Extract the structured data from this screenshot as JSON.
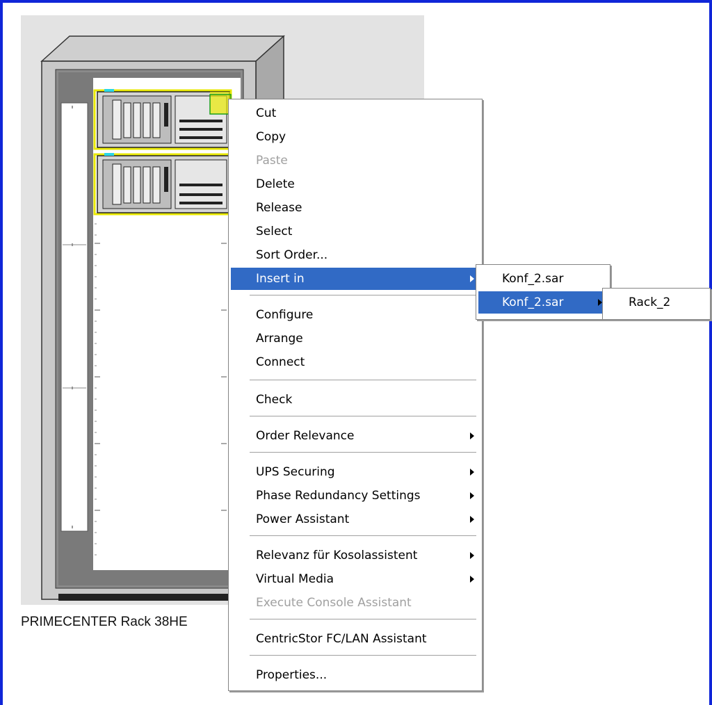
{
  "rack": {
    "label": "PRIMECENTER Rack 38HE"
  },
  "context_menu": {
    "items": [
      {
        "label": "Cut"
      },
      {
        "label": "Copy"
      },
      {
        "label": "Paste"
      },
      {
        "label": "Delete"
      },
      {
        "label": "Release"
      },
      {
        "label": "Select"
      },
      {
        "label": "Sort Order..."
      },
      {
        "label": "Insert in"
      },
      {
        "label": "Configure"
      },
      {
        "label": "Arrange"
      },
      {
        "label": "Connect"
      },
      {
        "label": "Check"
      },
      {
        "label": "Order Relevance"
      },
      {
        "label": "UPS Securing"
      },
      {
        "label": "Phase Redundancy Settings"
      },
      {
        "label": "Power Assistant"
      },
      {
        "label": "Relevanz für Kosolassistent"
      },
      {
        "label": "Virtual Media"
      },
      {
        "label": "Execute Console Assistant"
      },
      {
        "label": "CentricStor FC/LAN Assistant"
      },
      {
        "label": "Properties..."
      }
    ]
  },
  "submenu_1": {
    "items": [
      {
        "label": "Konf_2.sar"
      },
      {
        "label": "Konf_2.sar"
      }
    ]
  },
  "submenu_2": {
    "items": [
      {
        "label": "Rack_2"
      }
    ]
  },
  "colors": {
    "highlight": "#316ac5",
    "frame_border": "#1026d8",
    "disabled_text": "#a0a0a0"
  }
}
